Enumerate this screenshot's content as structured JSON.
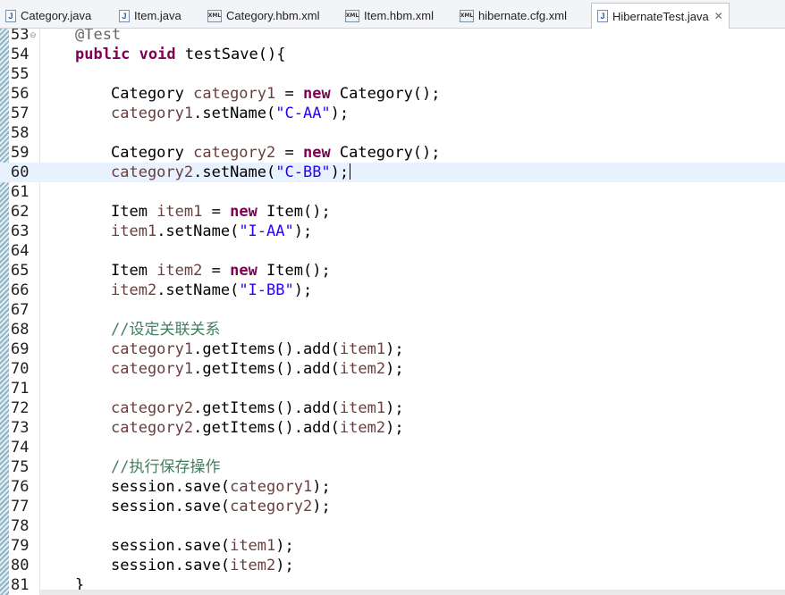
{
  "tabs": [
    {
      "label": "Category.java",
      "icon": "java-file-icon"
    },
    {
      "label": "Item.java",
      "icon": "java-file-icon"
    },
    {
      "label": "Category.hbm.xml",
      "icon": "xml-file-icon"
    },
    {
      "label": "Item.hbm.xml",
      "icon": "xml-file-icon"
    },
    {
      "label": "hibernate.cfg.xml",
      "icon": "xml-file-icon"
    },
    {
      "label": "HibernateTest.java",
      "icon": "java-file-icon",
      "active": true,
      "close": "✕"
    }
  ],
  "java_icon_glyph": "J",
  "xml_icon_glyph": "XML",
  "line_numbers": [
    "53",
    "54",
    "55",
    "56",
    "57",
    "58",
    "59",
    "60",
    "61",
    "62",
    "63",
    "64",
    "65",
    "66",
    "67",
    "68",
    "69",
    "70",
    "71",
    "72",
    "73",
    "74",
    "75",
    "76",
    "77",
    "78",
    "79",
    "80",
    "81"
  ],
  "current_line": "60",
  "code": {
    "l53": "@Test",
    "l54_kw1": "public",
    "l54_kw2": "void",
    "l54_rest": " testSave(){",
    "l56_type": "Category ",
    "l56_var": "category1",
    "l56_eq": " = ",
    "l56_new": "new",
    "l56_rest": " Category();",
    "l57_var": "category1",
    "l57_call": ".setName(",
    "l57_str": "\"C-AA\"",
    "l57_end": ");",
    "l59_type": "Category ",
    "l59_var": "category2",
    "l59_eq": " = ",
    "l59_new": "new",
    "l59_rest": " Category();",
    "l60_var": "category2",
    "l60_call": ".setName(",
    "l60_str": "\"C-BB\"",
    "l60_end": ");",
    "l62_type": "Item ",
    "l62_var": "item1",
    "l62_eq": " = ",
    "l62_new": "new",
    "l62_rest": " Item();",
    "l63_var": "item1",
    "l63_call": ".setName(",
    "l63_str": "\"I-AA\"",
    "l63_end": ");",
    "l65_type": "Item ",
    "l65_var": "item2",
    "l65_eq": " = ",
    "l65_new": "new",
    "l65_rest": " Item();",
    "l66_var": "item2",
    "l66_call": ".setName(",
    "l66_str": "\"I-BB\"",
    "l66_end": ");",
    "l68_comment": "//设定关联关系",
    "l69_var": "category1",
    "l69_call": ".getItems().add(",
    "l69_arg": "item1",
    "l69_end": ");",
    "l70_var": "category1",
    "l70_call": ".getItems().add(",
    "l70_arg": "item2",
    "l70_end": ");",
    "l72_var": "category2",
    "l72_call": ".getItems().add(",
    "l72_arg": "item1",
    "l72_end": ");",
    "l73_var": "category2",
    "l73_call": ".getItems().add(",
    "l73_arg": "item2",
    "l73_end": ");",
    "l75_comment": "//执行保存操作",
    "l76_obj": "session",
    "l76_call": ".save(",
    "l76_arg": "category1",
    "l76_end": ");",
    "l77_obj": "session",
    "l77_call": ".save(",
    "l77_arg": "category2",
    "l77_end": ");",
    "l79_obj": "session",
    "l79_call": ".save(",
    "l79_arg": "item1",
    "l79_end": ");",
    "l80_obj": "session",
    "l80_call": ".save(",
    "l80_arg": "item2",
    "l80_end": ");",
    "l81": "}"
  }
}
